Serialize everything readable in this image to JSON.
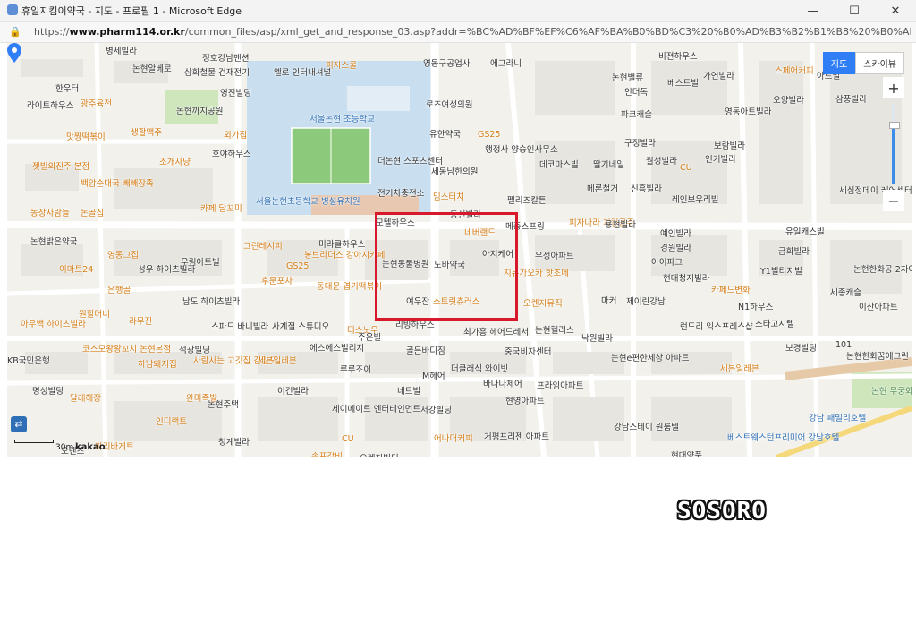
{
  "window": {
    "title": "휴일지킴이약국 - 지도 - 프로필 1 - Microsoft Edge",
    "minimize": "—",
    "maximize": "☐",
    "close": "✕"
  },
  "address_bar": {
    "scheme": "https://",
    "host": "www.pharm114.or.kr",
    "path": "/common_files/asp/xml_get_and_response_03.asp?addr=%BC%AD%BF%EF%C6%AF%BA%B0%BD%C3%20%B0%AD%B3%B2%B1%B8%20%B0%AD%B3%B2%B4%EB%B7..."
  },
  "map": {
    "view_buttons": [
      "지도",
      "스카이뷰"
    ],
    "zoom_in": "+",
    "zoom_out": "−",
    "zoom_level_fraction": 0.75,
    "scale": "30m",
    "brand": "kakao",
    "target_label": "노바약국",
    "labels": [
      "병세빌라",
      "정호강남맨션",
      "논현알베로",
      "삼화철물 건재전기",
      "엘로 인터내셔널",
      "피자스쿨",
      "영동구공업사",
      "에그라니",
      "비젼하우스",
      "스페어커피",
      "아트빌",
      "한우터",
      "라이트하우스",
      "광주육전",
      "논현까치공원",
      "영진빌딩",
      "서울논현 초등학교",
      "로즈여성의원",
      "논현밸류",
      "베스트빌",
      "가연빌라",
      "삼풍빌라",
      "인더독",
      "오양빌라",
      "맛짱떡볶이",
      "생활맥주",
      "외가집",
      "유한약국",
      "GS25",
      "행정사 양승인사무소",
      "파크캐슬",
      "영동아트빌라",
      "구정빌라",
      "보람빌라",
      "젯빌의진주 본점",
      "조개사냥",
      "호야하우스",
      "더논현 스포츠센터",
      "세동남한의원",
      "데코마스빌",
      "딸기네일",
      "월성빌라",
      "CU",
      "인기빌라",
      "백암순대국 빼빼장족",
      "전기차충전소",
      "밈스터치",
      "펠리즈칼튼",
      "메론철거",
      "신흥빌라",
      "레인보우리빌",
      "세심정데이 케어센터",
      "농장사람들",
      "논골집",
      "카페 달꼬미",
      "서울논현초등학교 병설유치원",
      "모텔하우스",
      "동신빌라",
      "메종스프링",
      "피자나라 치킨공주",
      "용현빌라",
      "유일캐스빌",
      "논현밝은약국",
      "그린레시피",
      "미라클하우스",
      "네버랜드",
      "예인빌라",
      "금화빌라",
      "영동그집",
      "우림아트빌",
      "GS25",
      "봉브라더스 강아지카페",
      "논현동물병원",
      "노바약국",
      "아지케어",
      "우성아파트",
      "경원빌라",
      "아이파크",
      "Y1빌티지빌",
      "논현한화공 2차아파",
      "이마트24",
      "성우 하이츠빌라",
      "후문포차",
      "지유가오카 핫초메",
      "현대청지빌라",
      "은행골",
      "동대문 엽기떡볶이",
      "카페드변화",
      "세종캐슬",
      "이산아파트",
      "원할머니",
      "라무진",
      "남도 하이츠빌라",
      "여우잔",
      "스트릿츄러스",
      "오렌지뮤직",
      "마커",
      "제이린강남",
      "N1하우스",
      "아우백 하이츠빌라",
      "스파드 바니빌라",
      "사계절 스튜디오",
      "더스노우",
      "리빙하우스",
      "최가흥 헤어드레서",
      "논현헬리스",
      "낙원빌라",
      "런드리 익스프레스샵",
      "스타고시텔",
      "코스모왕왕꼬치 논현본점",
      "석광빌딩",
      "에스에스빌리지",
      "주은빌",
      "골든바디짐",
      "중국비자센터",
      "논현e편한세상 아파트",
      "보경빌딩",
      "101",
      "KB국민은행",
      "하남돼지집",
      "사람사는 고깃집 김일도",
      "세븐일레븐",
      "루루조이",
      "M헤어",
      "더클래식 와이빗",
      "세븐일레븐",
      "논현한화꿈에그린 1차아파트",
      "명성빌딩",
      "달래해장",
      "이건빌라",
      "제이메이트 엔터테인먼트",
      "네트빌",
      "바나나체어",
      "프라임아파트",
      "논현 무궁화공원",
      "완미족발",
      "논현주택",
      "서강빌딩",
      "현영아파트",
      "강남 패밀리호텔",
      "인디랙트",
      "청계빌라",
      "CU",
      "어나더커피",
      "거평프리젠 아파트",
      "강남스테이 원룸텔",
      "베스트웨스턴프리미어 강남호텔",
      "오렌즈",
      "파리바게트",
      "솔포갈비",
      "오렌지빌딩",
      "현대양품"
    ]
  },
  "watermark": "SOSORO"
}
